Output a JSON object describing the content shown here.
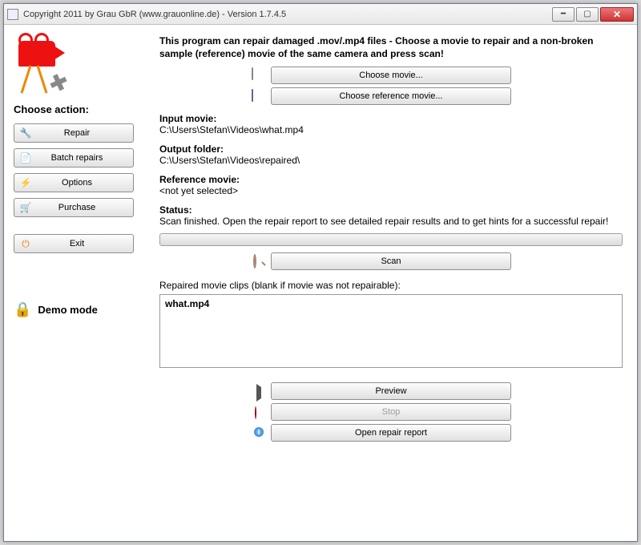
{
  "window": {
    "title": "Copyright 2011 by Grau GbR (www.grauonline.de) - Version 1.7.4.5"
  },
  "sidebar": {
    "heading": "Choose action:",
    "buttons": {
      "repair": "Repair",
      "batch": "Batch repairs",
      "options": "Options",
      "purchase": "Purchase",
      "exit": "Exit"
    },
    "demo": "Demo mode"
  },
  "main": {
    "intro": "This program can repair damaged .mov/.mp4 files - Choose a movie to repair and a non-broken sample (reference) movie of the same camera and press scan!",
    "choose_movie": "Choose movie...",
    "choose_ref": "Choose reference movie...",
    "input_label": "Input movie:",
    "input_value": "C:\\Users\\Stefan\\Videos\\what.mp4",
    "output_label": "Output folder:",
    "output_value": "C:\\Users\\Stefan\\Videos\\repaired\\",
    "ref_label": "Reference movie:",
    "ref_value": "<not yet selected>",
    "status_label": "Status:",
    "status_value": "Scan finished. Open the repair report to see detailed repair results and to get hints for a successful repair!",
    "scan": "Scan",
    "list_label": "Repaired movie clips (blank if movie was not repairable):",
    "list_items": [
      "what.mp4"
    ],
    "preview": "Preview",
    "stop": "Stop",
    "report": "Open repair report"
  }
}
